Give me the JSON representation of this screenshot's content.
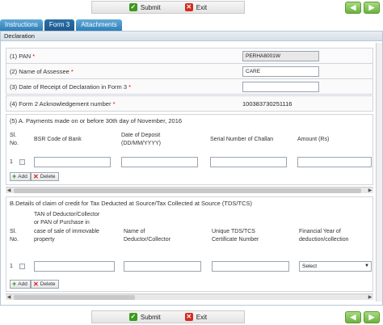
{
  "toolbar": {
    "submit_label": "Submit",
    "exit_label": "Exit",
    "prev_icon": "arrow-left-icon",
    "next_icon": "arrow-right-icon"
  },
  "tabs": [
    {
      "label": "Instructions"
    },
    {
      "label": "Form 3"
    },
    {
      "label": "Attachments"
    }
  ],
  "panel": {
    "title": "Declaration"
  },
  "fields": {
    "pan": {
      "label": "(1) PAN",
      "value": "PERHA8001W"
    },
    "assessee": {
      "label": "(2) Name of Assessee",
      "value": "CARE"
    },
    "receipt_date": {
      "label": "(3) Date of Receipt of Declaration in Form 3",
      "value": ""
    },
    "ack": {
      "label": "(4) Form 2 Acknowledgement number",
      "value": "100383730251116"
    }
  },
  "section_a": {
    "title": "(5) A. Payments made on or before 30th day of November, 2016",
    "headers": {
      "sl": "Sl.",
      "no": "No.",
      "bsr": "BSR Code of Bank",
      "date1": "Date of Deposit",
      "date2": "(DD/MM/YYYY)",
      "serial": "Serial Number of Challan",
      "amount": "Amount (Rs)"
    },
    "rows": [
      {
        "num": "1"
      }
    ],
    "add_label": "Add",
    "delete_label": "Delete"
  },
  "section_b": {
    "title": "B.Details of claim of credit for Tax Deducted at Source/Tax Collected at Source (TDS/TCS)",
    "headers": {
      "sl": "Sl.",
      "no": "No.",
      "tan1": "TAN of Deductor/Collector",
      "tan2": "or PAN of Purchase in",
      "tan3": "case of sale of immovable",
      "tan4": "property",
      "name1": "Name of",
      "name2": "Deductor/Collector",
      "cert1": "Unique TDS/TCS",
      "cert2": "Certificate Number",
      "fy1": "Financial Year of",
      "fy2": "deduction/collection"
    },
    "rows": [
      {
        "num": "1",
        "fy_selected": "Select"
      }
    ],
    "add_label": "Add",
    "delete_label": "Delete"
  },
  "colors": {
    "tab": "#2f7fb9",
    "nav_green": "#6cb23f",
    "submit_green": "#3c9a1e",
    "exit_red": "#d42a1e"
  }
}
